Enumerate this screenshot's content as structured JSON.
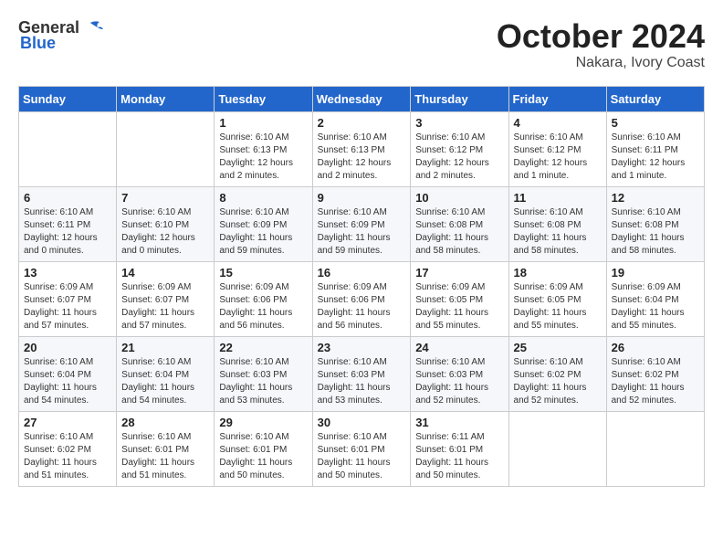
{
  "header": {
    "logo": {
      "general": "General",
      "blue": "Blue"
    },
    "month": "October 2024",
    "location": "Nakara, Ivory Coast"
  },
  "weekdays": [
    "Sunday",
    "Monday",
    "Tuesday",
    "Wednesday",
    "Thursday",
    "Friday",
    "Saturday"
  ],
  "weeks": [
    [
      null,
      null,
      {
        "day": "1",
        "sunrise": "Sunrise: 6:10 AM",
        "sunset": "Sunset: 6:13 PM",
        "daylight": "Daylight: 12 hours and 2 minutes."
      },
      {
        "day": "2",
        "sunrise": "Sunrise: 6:10 AM",
        "sunset": "Sunset: 6:13 PM",
        "daylight": "Daylight: 12 hours and 2 minutes."
      },
      {
        "day": "3",
        "sunrise": "Sunrise: 6:10 AM",
        "sunset": "Sunset: 6:12 PM",
        "daylight": "Daylight: 12 hours and 2 minutes."
      },
      {
        "day": "4",
        "sunrise": "Sunrise: 6:10 AM",
        "sunset": "Sunset: 6:12 PM",
        "daylight": "Daylight: 12 hours and 1 minute."
      },
      {
        "day": "5",
        "sunrise": "Sunrise: 6:10 AM",
        "sunset": "Sunset: 6:11 PM",
        "daylight": "Daylight: 12 hours and 1 minute."
      }
    ],
    [
      {
        "day": "6",
        "sunrise": "Sunrise: 6:10 AM",
        "sunset": "Sunset: 6:11 PM",
        "daylight": "Daylight: 12 hours and 0 minutes."
      },
      {
        "day": "7",
        "sunrise": "Sunrise: 6:10 AM",
        "sunset": "Sunset: 6:10 PM",
        "daylight": "Daylight: 12 hours and 0 minutes."
      },
      {
        "day": "8",
        "sunrise": "Sunrise: 6:10 AM",
        "sunset": "Sunset: 6:09 PM",
        "daylight": "Daylight: 11 hours and 59 minutes."
      },
      {
        "day": "9",
        "sunrise": "Sunrise: 6:10 AM",
        "sunset": "Sunset: 6:09 PM",
        "daylight": "Daylight: 11 hours and 59 minutes."
      },
      {
        "day": "10",
        "sunrise": "Sunrise: 6:10 AM",
        "sunset": "Sunset: 6:08 PM",
        "daylight": "Daylight: 11 hours and 58 minutes."
      },
      {
        "day": "11",
        "sunrise": "Sunrise: 6:10 AM",
        "sunset": "Sunset: 6:08 PM",
        "daylight": "Daylight: 11 hours and 58 minutes."
      },
      {
        "day": "12",
        "sunrise": "Sunrise: 6:10 AM",
        "sunset": "Sunset: 6:08 PM",
        "daylight": "Daylight: 11 hours and 58 minutes."
      }
    ],
    [
      {
        "day": "13",
        "sunrise": "Sunrise: 6:09 AM",
        "sunset": "Sunset: 6:07 PM",
        "daylight": "Daylight: 11 hours and 57 minutes."
      },
      {
        "day": "14",
        "sunrise": "Sunrise: 6:09 AM",
        "sunset": "Sunset: 6:07 PM",
        "daylight": "Daylight: 11 hours and 57 minutes."
      },
      {
        "day": "15",
        "sunrise": "Sunrise: 6:09 AM",
        "sunset": "Sunset: 6:06 PM",
        "daylight": "Daylight: 11 hours and 56 minutes."
      },
      {
        "day": "16",
        "sunrise": "Sunrise: 6:09 AM",
        "sunset": "Sunset: 6:06 PM",
        "daylight": "Daylight: 11 hours and 56 minutes."
      },
      {
        "day": "17",
        "sunrise": "Sunrise: 6:09 AM",
        "sunset": "Sunset: 6:05 PM",
        "daylight": "Daylight: 11 hours and 55 minutes."
      },
      {
        "day": "18",
        "sunrise": "Sunrise: 6:09 AM",
        "sunset": "Sunset: 6:05 PM",
        "daylight": "Daylight: 11 hours and 55 minutes."
      },
      {
        "day": "19",
        "sunrise": "Sunrise: 6:09 AM",
        "sunset": "Sunset: 6:04 PM",
        "daylight": "Daylight: 11 hours and 55 minutes."
      }
    ],
    [
      {
        "day": "20",
        "sunrise": "Sunrise: 6:10 AM",
        "sunset": "Sunset: 6:04 PM",
        "daylight": "Daylight: 11 hours and 54 minutes."
      },
      {
        "day": "21",
        "sunrise": "Sunrise: 6:10 AM",
        "sunset": "Sunset: 6:04 PM",
        "daylight": "Daylight: 11 hours and 54 minutes."
      },
      {
        "day": "22",
        "sunrise": "Sunrise: 6:10 AM",
        "sunset": "Sunset: 6:03 PM",
        "daylight": "Daylight: 11 hours and 53 minutes."
      },
      {
        "day": "23",
        "sunrise": "Sunrise: 6:10 AM",
        "sunset": "Sunset: 6:03 PM",
        "daylight": "Daylight: 11 hours and 53 minutes."
      },
      {
        "day": "24",
        "sunrise": "Sunrise: 6:10 AM",
        "sunset": "Sunset: 6:03 PM",
        "daylight": "Daylight: 11 hours and 52 minutes."
      },
      {
        "day": "25",
        "sunrise": "Sunrise: 6:10 AM",
        "sunset": "Sunset: 6:02 PM",
        "daylight": "Daylight: 11 hours and 52 minutes."
      },
      {
        "day": "26",
        "sunrise": "Sunrise: 6:10 AM",
        "sunset": "Sunset: 6:02 PM",
        "daylight": "Daylight: 11 hours and 52 minutes."
      }
    ],
    [
      {
        "day": "27",
        "sunrise": "Sunrise: 6:10 AM",
        "sunset": "Sunset: 6:02 PM",
        "daylight": "Daylight: 11 hours and 51 minutes."
      },
      {
        "day": "28",
        "sunrise": "Sunrise: 6:10 AM",
        "sunset": "Sunset: 6:01 PM",
        "daylight": "Daylight: 11 hours and 51 minutes."
      },
      {
        "day": "29",
        "sunrise": "Sunrise: 6:10 AM",
        "sunset": "Sunset: 6:01 PM",
        "daylight": "Daylight: 11 hours and 50 minutes."
      },
      {
        "day": "30",
        "sunrise": "Sunrise: 6:10 AM",
        "sunset": "Sunset: 6:01 PM",
        "daylight": "Daylight: 11 hours and 50 minutes."
      },
      {
        "day": "31",
        "sunrise": "Sunrise: 6:11 AM",
        "sunset": "Sunset: 6:01 PM",
        "daylight": "Daylight: 11 hours and 50 minutes."
      },
      null,
      null
    ]
  ]
}
